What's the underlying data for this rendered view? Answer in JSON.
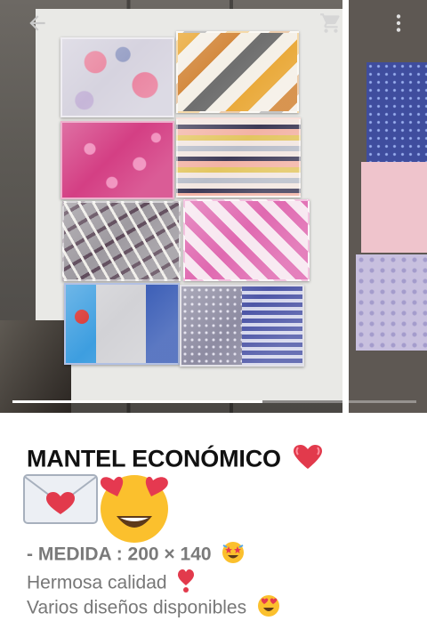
{
  "gallery": {
    "image_count": 2,
    "progress": 0.62,
    "icons": {
      "back": "arrow-back-icon",
      "cart": "cart-icon",
      "more": "more-vert-icon"
    }
  },
  "product": {
    "title": "MANTEL ECONÓMICO",
    "lines": [
      "- MEDIDA : 200 × 140",
      "Hermosa calidad",
      "Varios diseños disponibles"
    ],
    "emojis": [
      "heart-emoji",
      "envelope-heart-emoji",
      "heart-eyes-face-emoji",
      "star-struck-emoji",
      "exclamation-heart-emoji",
      "heart-eyes-face-emoji"
    ]
  }
}
